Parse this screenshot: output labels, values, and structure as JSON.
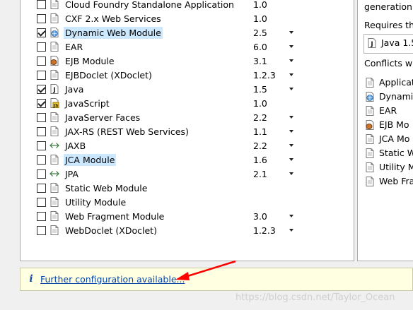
{
  "facets": [
    {
      "name": "Cloud Foundry Standalone Application",
      "version": "1.0",
      "checked": false,
      "icon": "doc-icon",
      "selected": false,
      "dropdown": false
    },
    {
      "name": "CXF 2.x Web Services",
      "version": "1.0",
      "checked": false,
      "icon": "doc-icon",
      "selected": false,
      "dropdown": false
    },
    {
      "name": "Dynamic Web Module",
      "version": "2.5",
      "checked": true,
      "icon": "web-module-icon",
      "selected": true,
      "dropdown": true
    },
    {
      "name": "EAR",
      "version": "6.0",
      "checked": false,
      "icon": "doc-icon",
      "selected": false,
      "dropdown": true
    },
    {
      "name": "EJB Module",
      "version": "3.1",
      "checked": false,
      "icon": "ejb-icon",
      "selected": false,
      "dropdown": true
    },
    {
      "name": "EJBDoclet (XDoclet)",
      "version": "1.2.3",
      "checked": false,
      "icon": "doc-icon",
      "selected": false,
      "dropdown": true
    },
    {
      "name": "Java",
      "version": "1.5",
      "checked": true,
      "icon": "java-icon",
      "selected": false,
      "dropdown": true
    },
    {
      "name": "JavaScript",
      "version": "1.0",
      "checked": true,
      "icon": "javascript-icon",
      "selected": false,
      "dropdown": false
    },
    {
      "name": "JavaServer Faces",
      "version": "2.2",
      "checked": false,
      "icon": "doc-icon",
      "selected": false,
      "dropdown": true
    },
    {
      "name": "JAX-RS (REST Web Services)",
      "version": "1.1",
      "checked": false,
      "icon": "doc-icon",
      "selected": false,
      "dropdown": true
    },
    {
      "name": "JAXB",
      "version": "2.2",
      "checked": false,
      "icon": "arrows-icon",
      "selected": false,
      "dropdown": true
    },
    {
      "name": "JCA Module",
      "version": "1.6",
      "checked": false,
      "icon": "doc-icon",
      "selected": true,
      "dropdown": true
    },
    {
      "name": "JPA",
      "version": "2.1",
      "checked": false,
      "icon": "arrows-icon",
      "selected": false,
      "dropdown": true
    },
    {
      "name": "Static Web Module",
      "version": "",
      "checked": false,
      "icon": "doc-icon",
      "selected": false,
      "dropdown": false
    },
    {
      "name": "Utility Module",
      "version": "",
      "checked": false,
      "icon": "doc-icon",
      "selected": false,
      "dropdown": false
    },
    {
      "name": "Web Fragment Module",
      "version": "3.0",
      "checked": false,
      "icon": "doc-icon",
      "selected": false,
      "dropdown": true
    },
    {
      "name": "WebDoclet (XDoclet)",
      "version": "1.2.3",
      "checked": false,
      "icon": "doc-icon",
      "selected": false,
      "dropdown": true
    }
  ],
  "details": {
    "description": "generation o",
    "requires_heading": "Requires the",
    "requires_item": "Java 1.5",
    "conflicts_heading": "Conflicts wit",
    "conflicts": [
      {
        "label": "Applicat",
        "icon": "doc-icon"
      },
      {
        "label": "Dynami",
        "icon": "web-module-icon"
      },
      {
        "label": "EAR",
        "icon": "doc-icon"
      },
      {
        "label": "EJB Mo",
        "icon": "ejb-icon"
      },
      {
        "label": "JCA Mo",
        "icon": "doc-icon"
      },
      {
        "label": "Static W",
        "icon": "doc-icon"
      },
      {
        "label": "Utility M",
        "icon": "doc-icon"
      },
      {
        "label": "Web Fra",
        "icon": "doc-icon"
      }
    ]
  },
  "info_bar": {
    "icon": "info-icon",
    "link": "Further configuration available..."
  },
  "watermark": "https://blog.csdn.net/Taylor_Ocean",
  "colors": {
    "selection": "#cce8ff",
    "info_background": "#ffffe1",
    "link": "#0645ad",
    "arrow": "#ff0000"
  }
}
